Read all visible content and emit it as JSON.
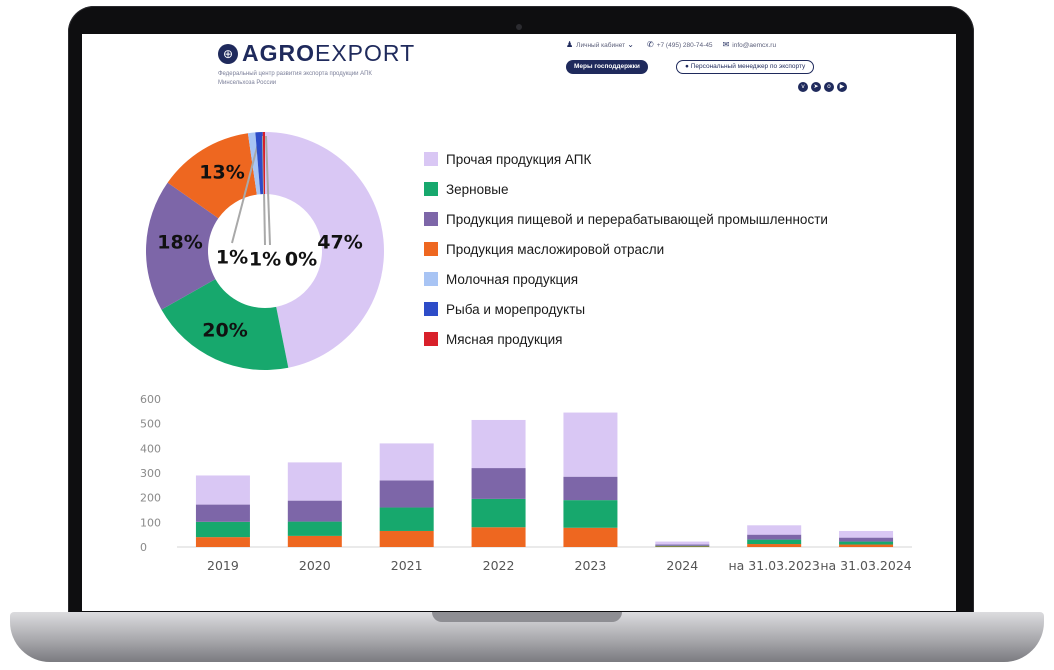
{
  "header": {
    "logo_bold": "AGRO",
    "logo_light": "EXPORT",
    "tagline": "Федеральный центр развития экспорта продукции АПК Минсельхоза России",
    "cabinet_link": "Личный кабинет",
    "phone": "+7 (495) 280-74-45",
    "email": "info@aemcx.ru",
    "support_button": "Меры господдержки",
    "manager_button": "Персональный менеджер по экспорту",
    "social_icons": [
      "vk-icon",
      "telegram-icon",
      "ok-icon",
      "youtube-icon"
    ],
    "brand_color": "#1f2a5c"
  },
  "chart_data": [
    {
      "type": "pie",
      "style": "donut",
      "series": [
        {
          "name": "Прочая продукция АПК",
          "value": 47,
          "label": "47%",
          "color": "#d9c7f4"
        },
        {
          "name": "Зерновые",
          "value": 20,
          "label": "20%",
          "color": "#17a86d"
        },
        {
          "name": "Продукция пищевой и перерабатывающей промышленности",
          "value": 18,
          "label": "18%",
          "color": "#7d66a8"
        },
        {
          "name": "Продукция масложировой отрасли",
          "value": 13,
          "label": "13%",
          "color": "#ee6720"
        },
        {
          "name": "Молочная продукция",
          "value": 1,
          "label": "1%",
          "color": "#a8c4f4"
        },
        {
          "name": "Рыба и морепродукты",
          "value": 1,
          "label": "1%",
          "color": "#2d4cc8"
        },
        {
          "name": "Мясная продукция",
          "value": 0.3,
          "label": "0%",
          "color": "#d8202a"
        }
      ],
      "legend_position": "right"
    },
    {
      "type": "bar",
      "stacked": true,
      "categories": [
        "2019",
        "2020",
        "2021",
        "2022",
        "2023",
        "2024",
        "на 31.03.2023",
        "на 31.03.2024"
      ],
      "series": [
        {
          "color": "#ee6720",
          "values": [
            40,
            45,
            65,
            80,
            78,
            2,
            12,
            10
          ]
        },
        {
          "color": "#17a86d",
          "values": [
            62,
            58,
            95,
            115,
            112,
            3,
            18,
            12
          ]
        },
        {
          "color": "#7d66a8",
          "values": [
            70,
            85,
            110,
            125,
            95,
            5,
            20,
            16
          ]
        },
        {
          "color": "#d9c7f4",
          "values": [
            118,
            155,
            150,
            195,
            260,
            12,
            38,
            27
          ]
        }
      ],
      "ylim": [
        0,
        600
      ],
      "yticks": [
        "600",
        "500",
        "400",
        "300",
        "200",
        "100",
        "0"
      ],
      "ytick_values": [
        600,
        500,
        400,
        300,
        200,
        100,
        0
      ],
      "grid": false
    }
  ]
}
